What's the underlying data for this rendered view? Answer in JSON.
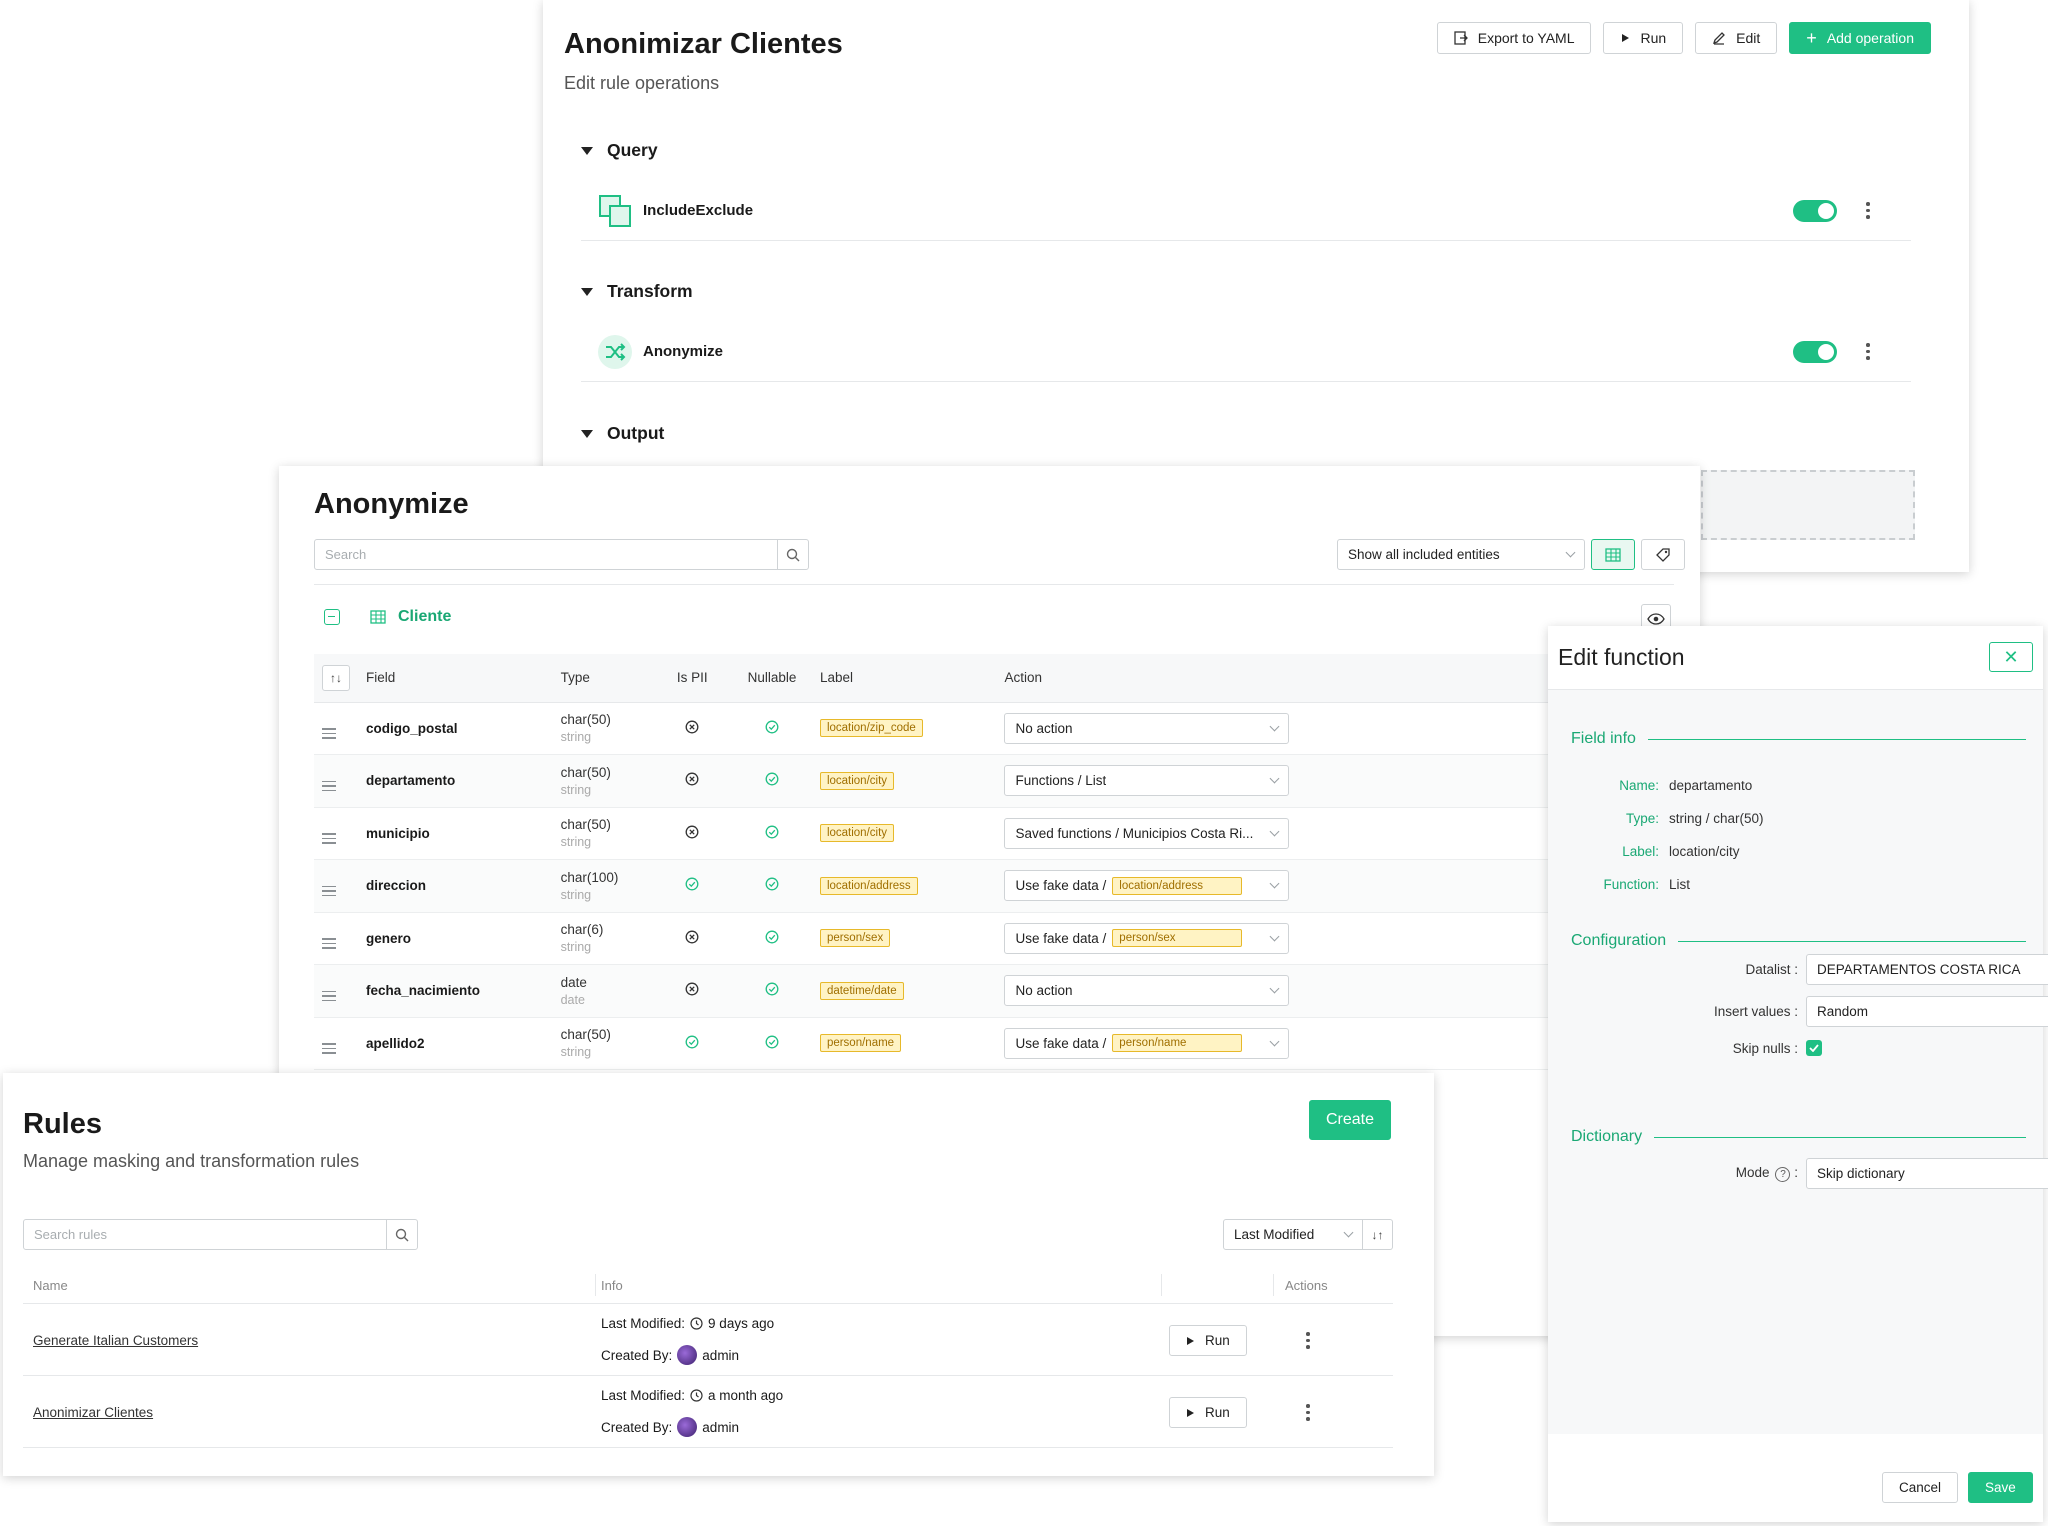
{
  "rule_editor": {
    "title": "Anonimizar Clientes",
    "subtitle": "Edit rule operations",
    "toolbar": {
      "export_label": "Export to YAML",
      "run_label": "Run",
      "edit_label": "Edit",
      "add_label": "Add operation"
    },
    "sections": [
      {
        "name": "Query",
        "operations": [
          {
            "name": "IncludeExclude",
            "enabled": true
          }
        ]
      },
      {
        "name": "Transform",
        "operations": [
          {
            "name": "Anonymize",
            "enabled": true
          }
        ]
      },
      {
        "name": "Output",
        "operations": []
      }
    ]
  },
  "anonymize": {
    "title": "Anonymize",
    "search_placeholder": "Search",
    "filter_value": "Show all included entities",
    "entity": "Cliente",
    "columns": [
      "Field",
      "Type",
      "Is PII",
      "Nullable",
      "Label",
      "Action"
    ],
    "rows": [
      {
        "field": "codigo_postal",
        "type": "char(50)",
        "base_type": "string",
        "is_pii": false,
        "nullable": true,
        "label": "location/zip_code",
        "action": "No action",
        "action_tag": ""
      },
      {
        "field": "departamento",
        "type": "char(50)",
        "base_type": "string",
        "is_pii": false,
        "nullable": true,
        "label": "location/city",
        "action": "Functions / List",
        "action_tag": ""
      },
      {
        "field": "municipio",
        "type": "char(50)",
        "base_type": "string",
        "is_pii": false,
        "nullable": true,
        "label": "location/city",
        "action": "Saved functions / Municipios Costa Ri...",
        "action_tag": ""
      },
      {
        "field": "direccion",
        "type": "char(100)",
        "base_type": "string",
        "is_pii": true,
        "nullable": true,
        "label": "location/address",
        "action": "Use fake data /",
        "action_tag": "location/address"
      },
      {
        "field": "genero",
        "type": "char(6)",
        "base_type": "string",
        "is_pii": false,
        "nullable": true,
        "label": "person/sex",
        "action": "Use fake data /",
        "action_tag": "person/sex"
      },
      {
        "field": "fecha_nacimiento",
        "type": "date",
        "base_type": "date",
        "is_pii": false,
        "nullable": true,
        "label": "datetime/date",
        "action": "No action",
        "action_tag": ""
      },
      {
        "field": "apellido2",
        "type": "char(50)",
        "base_type": "string",
        "is_pii": true,
        "nullable": true,
        "label": "person/name",
        "action": "Use fake data /",
        "action_tag": "person/name"
      }
    ]
  },
  "rules": {
    "title": "Rules",
    "subtitle": "Manage masking and transformation rules",
    "create_label": "Create",
    "search_placeholder": "Search rules",
    "sort_value": "Last Modified",
    "columns": {
      "name": "Name",
      "info": "Info",
      "actions": "Actions"
    },
    "last_modified_label": "Last Modified:",
    "created_by_label": "Created By:",
    "run_label": "Run",
    "items": [
      {
        "name": "Generate Italian Customers",
        "last_modified": "9 days ago",
        "created_by": "admin"
      },
      {
        "name": "Anonimizar Clientes",
        "last_modified": "a month ago",
        "created_by": "admin"
      }
    ]
  },
  "edit_function": {
    "title": "Edit function",
    "field_info_heading": "Field info",
    "field_info": [
      {
        "key": "Name:",
        "value": "departamento"
      },
      {
        "key": "Type:",
        "value": "string / char(50)"
      },
      {
        "key": "Label:",
        "value": "location/city"
      },
      {
        "key": "Function:",
        "value": "List"
      }
    ],
    "configuration_heading": "Configuration",
    "datalist_label": "Datalist :",
    "datalist_value": "DEPARTAMENTOS COSTA RICA",
    "insert_label": "Insert values :",
    "insert_value": "Random",
    "skip_nulls_label": "Skip nulls :",
    "skip_nulls": true,
    "dictionary_heading": "Dictionary",
    "mode_label": "Mode",
    "mode_value": "Skip dictionary",
    "cancel_label": "Cancel",
    "save_label": "Save"
  },
  "colors": {
    "accent": "#1fbf84",
    "accent_text": "#1aa874",
    "tag_bg": "#fff3c4",
    "tag_border": "#e7b92a"
  }
}
